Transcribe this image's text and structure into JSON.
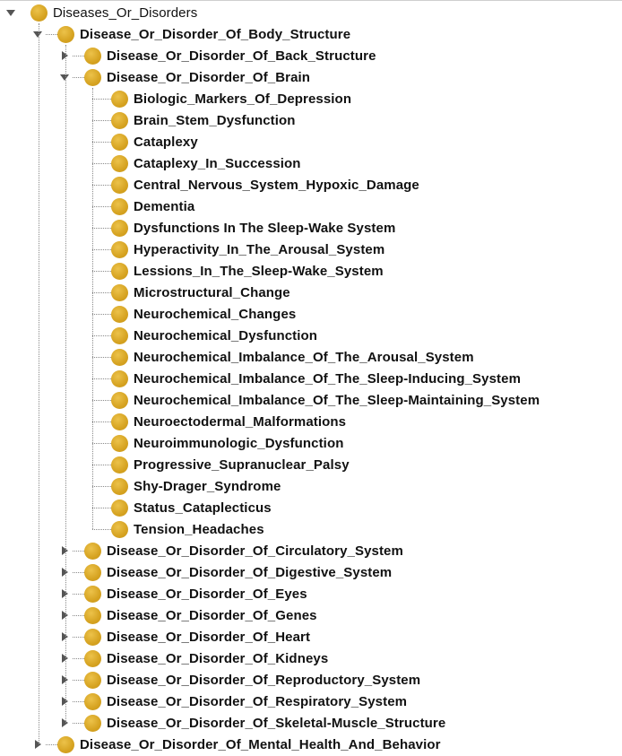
{
  "tree": {
    "root": {
      "label": "Diseases_Or_Disorders",
      "icon": "class-icon",
      "expanded": true,
      "children": [
        {
          "label": "Disease_Or_Disorder_Of_Body_Structure",
          "expanded": true,
          "children": [
            {
              "label": "Disease_Or_Disorder_Of_Back_Structure",
              "expanded": false,
              "has_children": true
            },
            {
              "label": "Disease_Or_Disorder_Of_Brain",
              "expanded": true,
              "children": [
                {
                  "label": "Biologic_Markers_Of_Depression"
                },
                {
                  "label": "Brain_Stem_Dysfunction"
                },
                {
                  "label": "Cataplexy"
                },
                {
                  "label": "Cataplexy_In_Succession"
                },
                {
                  "label": "Central_Nervous_System_Hypoxic_Damage"
                },
                {
                  "label": "Dementia"
                },
                {
                  "label": "Dysfunctions In The Sleep-Wake System"
                },
                {
                  "label": "Hyperactivity_In_The_Arousal_System"
                },
                {
                  "label": "Lessions_In_The_Sleep-Wake_System"
                },
                {
                  "label": "Microstructural_Change"
                },
                {
                  "label": "Neurochemical_Changes"
                },
                {
                  "label": "Neurochemical_Dysfunction"
                },
                {
                  "label": "Neurochemical_Imbalance_Of_The_Arousal_System"
                },
                {
                  "label": "Neurochemical_Imbalance_Of_The_Sleep-Inducing_System"
                },
                {
                  "label": "Neurochemical_Imbalance_Of_The_Sleep-Maintaining_System"
                },
                {
                  "label": "Neuroectodermal_Malformations"
                },
                {
                  "label": "Neuroimmunologic_Dysfunction"
                },
                {
                  "label": "Progressive_Supranuclear_Palsy"
                },
                {
                  "label": "Shy-Drager_Syndrome"
                },
                {
                  "label": "Status_Cataplecticus"
                },
                {
                  "label": "Tension_Headaches"
                }
              ]
            },
            {
              "label": "Disease_Or_Disorder_Of_Circulatory_System",
              "expanded": false,
              "has_children": true
            },
            {
              "label": "Disease_Or_Disorder_Of_Digestive_System",
              "expanded": false,
              "has_children": true
            },
            {
              "label": "Disease_Or_Disorder_Of_Eyes",
              "expanded": false,
              "has_children": true
            },
            {
              "label": "Disease_Or_Disorder_Of_Genes",
              "expanded": false,
              "has_children": true
            },
            {
              "label": "Disease_Or_Disorder_Of_Heart",
              "expanded": false,
              "has_children": true
            },
            {
              "label": "Disease_Or_Disorder_Of_Kidneys",
              "expanded": false,
              "has_children": true
            },
            {
              "label": "Disease_Or_Disorder_Of_Reproductory_System",
              "expanded": false,
              "has_children": true
            },
            {
              "label": "Disease_Or_Disorder_Of_Respiratory_System",
              "expanded": false,
              "has_children": true
            },
            {
              "label": "Disease_Or_Disorder_Of_Skeletal-Muscle_Structure",
              "expanded": false,
              "has_children": true
            }
          ]
        },
        {
          "label": "Disease_Or_Disorder_Of_Mental_Health_And_Behavior",
          "expanded": false,
          "has_children": true
        }
      ]
    }
  },
  "colors": {
    "node_icon": "#d6a321",
    "text": "#111111",
    "connector": "#8a8a8a",
    "toggle": "#555555"
  }
}
